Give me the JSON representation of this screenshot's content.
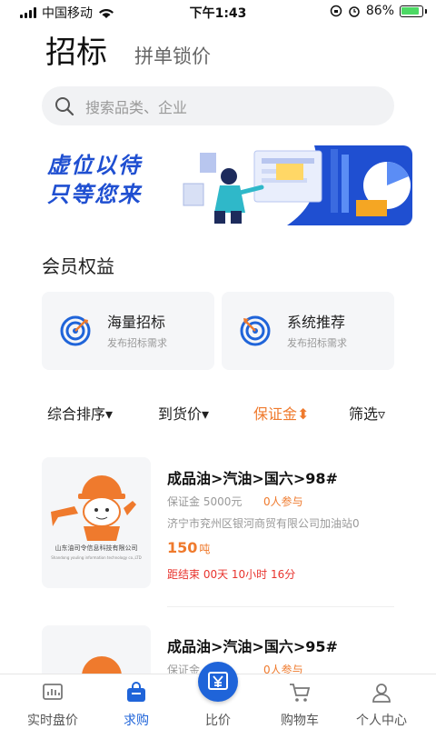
{
  "status": {
    "carrier": "中国移动",
    "time": "下午1:43",
    "battery": "86%"
  },
  "header": {
    "title": "招标",
    "subtitle": "拼单锁价"
  },
  "search": {
    "placeholder": "搜索品类、企业"
  },
  "banner": {
    "line1": "虚位以待",
    "line2": "只等您来"
  },
  "benefits": {
    "title": "会员权益",
    "cards": [
      {
        "name": "海量招标",
        "sub": "发布招标需求",
        "icon": "target-dart-icon"
      },
      {
        "name": "系统推荐",
        "sub": "发布招标需求",
        "icon": "target-arrow-icon"
      }
    ]
  },
  "filters": [
    {
      "label": "综合排序▾"
    },
    {
      "label": "到货价▾"
    },
    {
      "label": "保证金⬍",
      "active": true
    },
    {
      "label": "筛选▿"
    }
  ],
  "items": [
    {
      "title": "成品油>汽油>国六>98#",
      "deposit": "保证金 5000元",
      "participants": "0人参与",
      "company": "济宁市兖州区银河商贸有限公司加油站0",
      "qty": "150",
      "unit": "吨",
      "countdown": "距结束 00天 10小时 16分",
      "thumb_company": "山东油司令信息科技有限公司",
      "thumb_company_en": "Shandong youling information technology co.,LTD"
    },
    {
      "title": "成品油>汽油>国六>95#",
      "deposit": "保证金",
      "participants": "0人参与"
    }
  ],
  "tabbar": [
    {
      "label": "实时盘价",
      "icon": "chart-icon"
    },
    {
      "label": "求购",
      "icon": "bag-icon",
      "active": true
    },
    {
      "label": "比价",
      "icon": "yen-icon"
    },
    {
      "label": "购物车",
      "icon": "cart-icon"
    },
    {
      "label": "个人中心",
      "icon": "person-icon"
    }
  ],
  "colors": {
    "accent": "#1f64d9",
    "orange": "#ef7a2d",
    "red": "#e8332d"
  }
}
